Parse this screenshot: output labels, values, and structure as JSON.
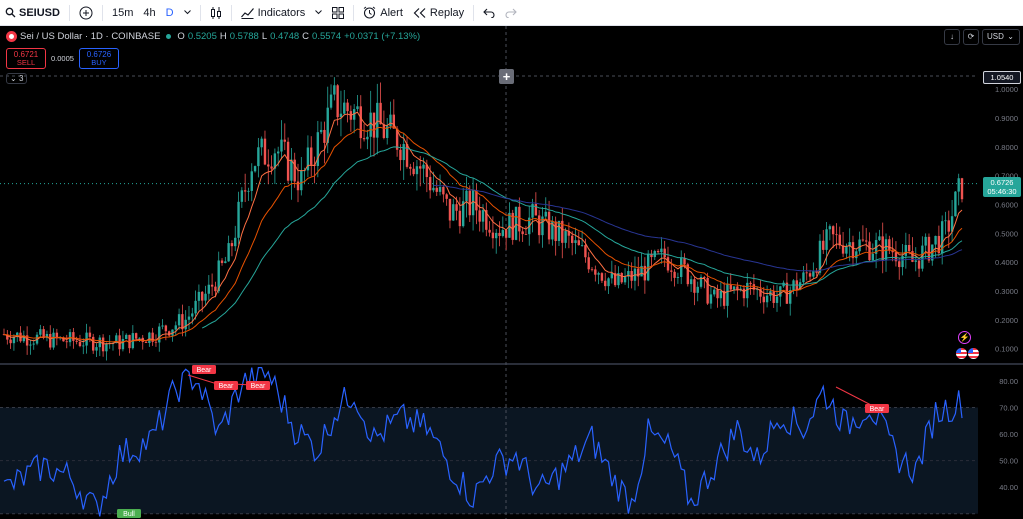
{
  "toolbar": {
    "symbol": "SEIUSD",
    "intervals": [
      "15m",
      "4h",
      "D"
    ],
    "active_interval": "D",
    "indicators_label": "Indicators",
    "alert_label": "Alert",
    "replay_label": "Replay",
    "icons": [
      "search-icon",
      "add-symbol-icon",
      "chevron-down-icon",
      "candles-icon",
      "indicators-icon",
      "templates-icon",
      "alert-icon",
      "replay-icon",
      "undo-icon",
      "redo-icon"
    ]
  },
  "legend": {
    "title": "Sei / US Dollar · 1D · COINBASE",
    "o_label": "O",
    "o": "0.5205",
    "h_label": "H",
    "h": "0.5788",
    "l_label": "L",
    "l": "0.4748",
    "c_label": "C",
    "c": "0.5574",
    "change": "+0.0371 (+7.13%)"
  },
  "trade": {
    "sell_price": "0.6721",
    "sell_label": "SELL",
    "spread": "0.0005",
    "buy_price": "0.6726",
    "buy_label": "BUY"
  },
  "collapse_count": "3",
  "top_right": {
    "currency": "USD"
  },
  "price_axis": {
    "ticks": [
      "1.0000",
      "0.9000",
      "0.8000",
      "0.7000",
      "0.6000",
      "0.5000",
      "0.4000",
      "0.3000",
      "0.2000",
      "0.1000"
    ],
    "crosshair_value": "1.0540",
    "last_price": "0.6726",
    "countdown": "05:46:30"
  },
  "rsi_axis": {
    "ticks": [
      "80.00",
      "70.00",
      "60.00",
      "50.00",
      "40.00"
    ]
  },
  "divergence_labels": {
    "bear": "Bear",
    "bull": "Bull"
  },
  "colors": {
    "up": "#26a69a",
    "down": "#ef5350",
    "ema_fast": "#ff7043",
    "ema_mid": "#e65100",
    "ema_slow": "#26a69a",
    "ema_long": "#283593",
    "rsi": "#2962ff",
    "bear": "#f23645",
    "bull": "#4caf50"
  },
  "chart_data": {
    "type": "candlestick",
    "price_ylim": [
      0.05,
      1.15
    ],
    "rsi_ylim": [
      28,
      86
    ],
    "anchors": [
      [
        0,
        0.15
      ],
      [
        15,
        0.13
      ],
      [
        35,
        0.12
      ],
      [
        45,
        0.15
      ],
      [
        55,
        0.2
      ],
      [
        62,
        0.3
      ],
      [
        68,
        0.42
      ],
      [
        75,
        0.75
      ],
      [
        82,
        0.8
      ],
      [
        90,
        0.68
      ],
      [
        100,
        0.95
      ],
      [
        110,
        0.9
      ],
      [
        120,
        0.82
      ],
      [
        128,
        0.7
      ],
      [
        135,
        0.57
      ],
      [
        142,
        0.6
      ],
      [
        150,
        0.52
      ],
      [
        160,
        0.55
      ],
      [
        170,
        0.48
      ],
      [
        178,
        0.4
      ],
      [
        185,
        0.32
      ],
      [
        192,
        0.36
      ],
      [
        200,
        0.42
      ],
      [
        208,
        0.35
      ],
      [
        215,
        0.27
      ],
      [
        225,
        0.31
      ],
      [
        235,
        0.28
      ],
      [
        242,
        0.34
      ],
      [
        250,
        0.48
      ],
      [
        260,
        0.46
      ],
      [
        270,
        0.44
      ],
      [
        275,
        0.4
      ],
      [
        285,
        0.5
      ],
      [
        290,
        0.67
      ]
    ],
    "rsi_anchors": [
      [
        0,
        39
      ],
      [
        12,
        48
      ],
      [
        20,
        44
      ],
      [
        28,
        31
      ],
      [
        35,
        52
      ],
      [
        45,
        58
      ],
      [
        52,
        77
      ],
      [
        58,
        82
      ],
      [
        65,
        60
      ],
      [
        72,
        79
      ],
      [
        80,
        83
      ],
      [
        88,
        62
      ],
      [
        95,
        54
      ],
      [
        100,
        68
      ],
      [
        106,
        76
      ],
      [
        112,
        58
      ],
      [
        120,
        66
      ],
      [
        128,
        62
      ],
      [
        135,
        48
      ],
      [
        142,
        36
      ],
      [
        148,
        48
      ],
      [
        155,
        52
      ],
      [
        162,
        38
      ],
      [
        170,
        47
      ],
      [
        178,
        58
      ],
      [
        185,
        42
      ],
      [
        190,
        34
      ],
      [
        195,
        60
      ],
      [
        202,
        54
      ],
      [
        208,
        34
      ],
      [
        215,
        48
      ],
      [
        222,
        62
      ],
      [
        228,
        50
      ],
      [
        235,
        68
      ],
      [
        242,
        62
      ],
      [
        248,
        76
      ],
      [
        255,
        63
      ],
      [
        262,
        71
      ],
      [
        270,
        52
      ],
      [
        276,
        46
      ],
      [
        282,
        68
      ],
      [
        290,
        72
      ]
    ]
  }
}
